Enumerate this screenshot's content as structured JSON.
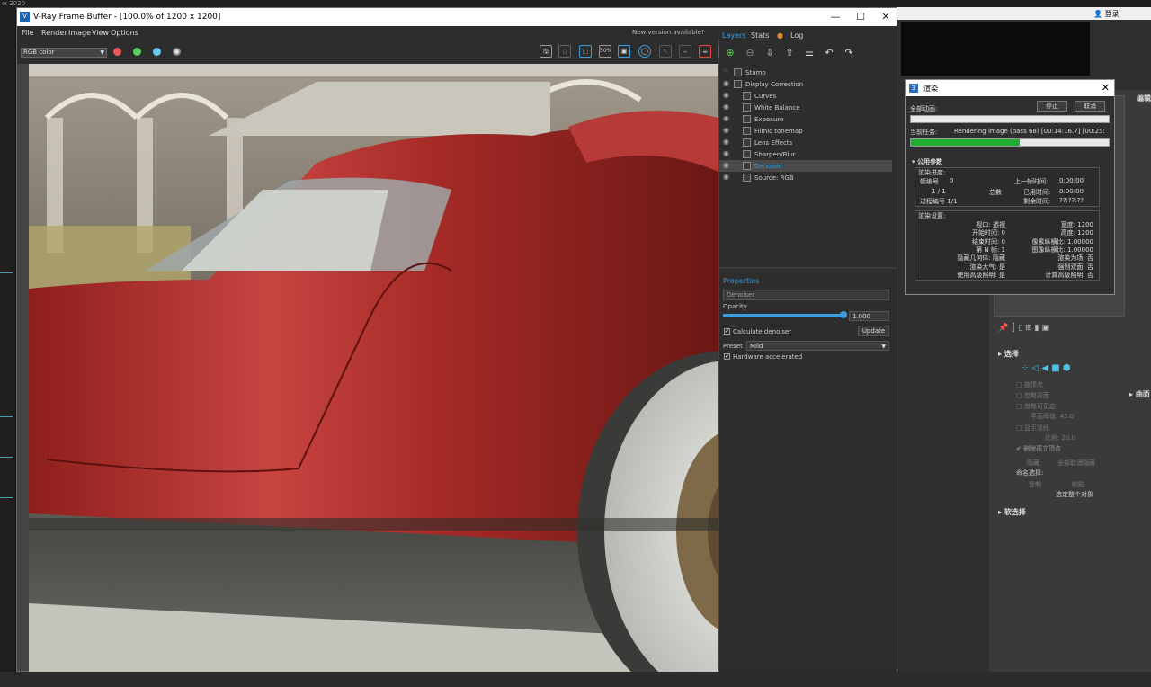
{
  "background": {
    "top_strip": "ıx 2020",
    "menu_login": "登录"
  },
  "vfb": {
    "title": "V-Ray Frame Buffer - [100.0% of 1200 x 1200]",
    "menu": [
      "File",
      "Render",
      "Image",
      "View",
      "Options"
    ],
    "new_version": "New version available!",
    "channel": "RGB color",
    "zoom_badge": "50%",
    "tabs": {
      "layers": "Layers",
      "stats": "Stats",
      "log": "Log"
    },
    "layers": [
      {
        "name": "Stamp",
        "indent": false,
        "selected": false
      },
      {
        "name": "Display Correction",
        "indent": false,
        "selected": false
      },
      {
        "name": "Curves",
        "indent": true,
        "selected": false
      },
      {
        "name": "White Balance",
        "indent": true,
        "selected": false
      },
      {
        "name": "Exposure",
        "indent": true,
        "selected": false
      },
      {
        "name": "Filmic tonemap",
        "indent": true,
        "selected": false
      },
      {
        "name": "Lens Effects",
        "indent": true,
        "selected": false
      },
      {
        "name": "Sharpen/Blur",
        "indent": true,
        "selected": false
      },
      {
        "name": "Denoiser",
        "indent": true,
        "selected": true
      },
      {
        "name": "Source: RGB",
        "indent": true,
        "selected": false
      }
    ],
    "properties": {
      "header": "Properties",
      "name_field": "Denoiser",
      "opacity_label": "Opacity",
      "opacity_value": "1.000",
      "opacity": 1.0,
      "calc_label": "Calculate denoiser",
      "update_label": "Update",
      "preset_label": "Preset",
      "preset_value": "Mild",
      "hw_label": "Hardware accelerated"
    }
  },
  "dialog": {
    "title": "渲染",
    "stop": "停止",
    "cancel": "取消",
    "all_frames_label": "全部动画:",
    "current_task_label": "当前任务:",
    "current_task_value": "Rendering image (pass 68) [00:14:16.7] [00:25:",
    "progress_fraction": 0.55,
    "common_params": "公用参数",
    "render_progress": "渲染进度:",
    "frame_no_label": "帧编号",
    "frame_no": "0",
    "prev_frame_label": "上一帧时间:",
    "prev_frame": "0:00:00",
    "frames_count": "1 / 1",
    "total_label": "总数",
    "elapsed_label": "已用时间:",
    "elapsed": "0:00:00",
    "pass_label": "过程编号 1/1",
    "remaining_label": "剩余时间:",
    "remaining": "??:??:??",
    "render_settings": "渲染设置:",
    "settings_left": [
      "视口: 透视",
      "开始时间: 0",
      "结束时间: 0",
      "第 N 帧: 1",
      "隐藏几何体: 隐藏",
      "渲染大气: 是",
      "使用高级照明: 是"
    ],
    "settings_right": [
      "宽度: 1200",
      "高度: 1200",
      "像素纵横比: 1.00000",
      "图像纵横比: 1.00000",
      "渲染为场: 否",
      "强制双面: 否",
      "计算高级照明: 否"
    ]
  },
  "cmdpanel": {
    "edit_label": "编辑",
    "select_header": "选择",
    "options": [
      "按顶点",
      "忽略背面",
      "忽略可见边",
      "平面阈值: 45.0",
      "显示法线",
      "比例: 20.0",
      "删除孤立顶点"
    ],
    "hide": "隐藏",
    "unhide_all": "全部取消隐藏",
    "named_sel": "命名选择:",
    "copy": "复制",
    "paste": "粘贴",
    "select_whole": "选定整个对象",
    "soft_select": "软选择",
    "surface": "曲面"
  }
}
